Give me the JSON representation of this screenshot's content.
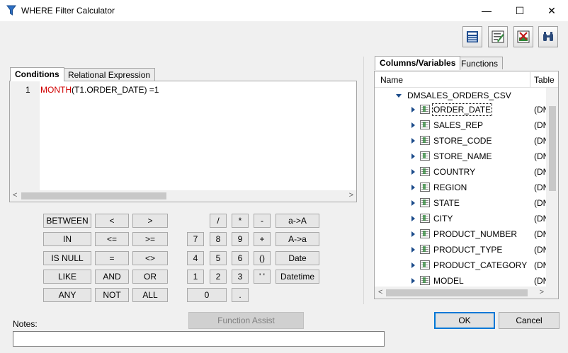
{
  "window": {
    "title": "WHERE Filter Calculator",
    "min_glyph": "—",
    "max_glyph": "☐",
    "close_glyph": "✕"
  },
  "toolbar": [
    {
      "icon": "sql-icon"
    },
    {
      "icon": "edit-sql-icon"
    },
    {
      "icon": "sql-cancel-icon"
    },
    {
      "icon": "binoculars-icon"
    }
  ],
  "left_tabs": {
    "conditions": "Conditions",
    "relational": "Relational Expression"
  },
  "editor": {
    "line_number": "1",
    "keyword": "MONTH",
    "expression": "(T1.ORDER_DATE) =1"
  },
  "operators": {
    "between": "BETWEEN",
    "in": "IN",
    "is_null": "IS NULL",
    "like": "LIKE",
    "any": "ANY",
    "lt": "<",
    "gt": ">",
    "le": "<=",
    "ge": ">=",
    "eq": "=",
    "ne": "<>",
    "and": "AND",
    "or": "OR",
    "not": "NOT",
    "all": "ALL"
  },
  "keypad": {
    "div": "/",
    "mul": "*",
    "minus": "-",
    "plus": "+",
    "paren": "()",
    "quote": "' '",
    "d7": "7",
    "d8": "8",
    "d9": "9",
    "d4": "4",
    "d5": "5",
    "d6": "6",
    "d1": "1",
    "d2": "2",
    "d3": "3",
    "d0": "0",
    "dot": "."
  },
  "functions": {
    "lower_to_upper": "a->A",
    "upper_to_lower": "A->a",
    "date": "Date",
    "datetime": "Datetime"
  },
  "function_assist": "Function Assist",
  "right_tabs": {
    "columns": "Columns/Variables",
    "functions": "Functions"
  },
  "tree": {
    "col_name": "Name",
    "col_table": "Table",
    "root": "DMSALES_ORDERS_CSV",
    "columns": [
      {
        "name": "ORDER_DATE",
        "table": "(DN"
      },
      {
        "name": "SALES_REP",
        "table": "(DN"
      },
      {
        "name": "STORE_CODE",
        "table": "(DN"
      },
      {
        "name": "STORE_NAME",
        "table": "(DN"
      },
      {
        "name": "COUNTRY",
        "table": "(DN"
      },
      {
        "name": "REGION",
        "table": "(DN"
      },
      {
        "name": "STATE",
        "table": "(DN"
      },
      {
        "name": "CITY",
        "table": "(DN"
      },
      {
        "name": "PRODUCT_NUMBER",
        "table": "(DN"
      },
      {
        "name": "PRODUCT_TYPE",
        "table": "(DN"
      },
      {
        "name": "PRODUCT_CATEGORY",
        "table": "(DN"
      },
      {
        "name": "MODEL",
        "table": "(DN"
      }
    ]
  },
  "buttons": {
    "ok": "OK",
    "cancel": "Cancel"
  },
  "notes": {
    "label": "Notes:",
    "value": ""
  }
}
